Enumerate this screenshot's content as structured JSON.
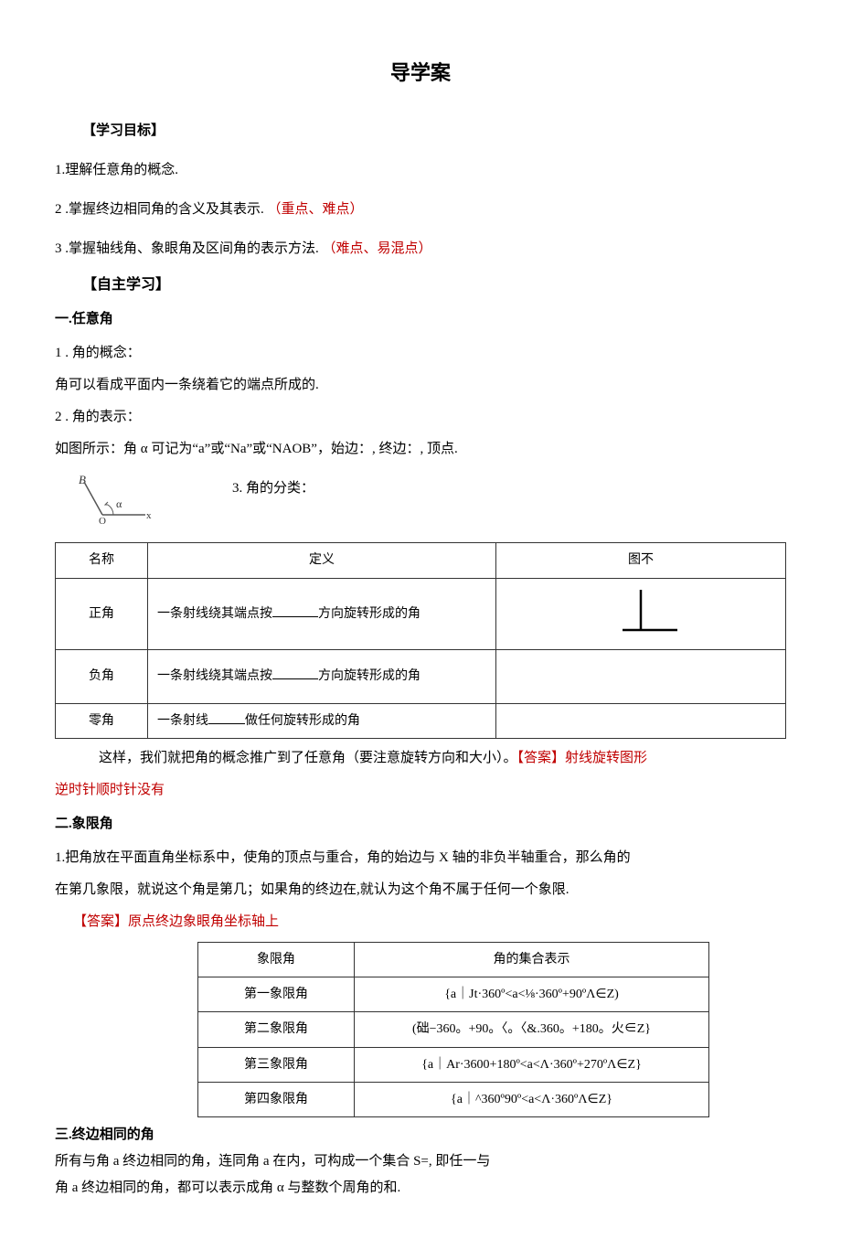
{
  "title": "导学案",
  "goals": {
    "header": "【学习目标】",
    "g1": "1.理解任意角的概念.",
    "g2_prefix": "2 .掌握终边相同角的含义及其表示. ",
    "g2_note": "（重点、难点）",
    "g3_prefix": "3 .掌握轴线角、象眼角及区间角的表示方法. ",
    "g3_note": "（难点、易混点）"
  },
  "self_study": "【自主学习】",
  "arb": {
    "head": "一.任意角",
    "c1": "1 . 角的概念：",
    "c2": "角可以看成平面内一条绕着它的端点所成的.",
    "c3": "2 . 角的表示：",
    "c4": "如图所示：角 α 可记为“a”或“Na”或“NAOB”，始边：, 终边：, 顶点.",
    "c5": "3. 角的分类："
  },
  "table1": {
    "h1": "名称",
    "h2": "定义",
    "h3": "图不",
    "r1c1": "正角",
    "r1c2a": "一条射线绕其端点按",
    "r1c2b": "方向旋转形成的角",
    "r2c1": "负角",
    "r2c2a": "一条射线绕其端点按",
    "r2c2b": "方向旋转形成的角",
    "r3c1": "零角",
    "r3c2a": "一条射线",
    "r3c2b": "做任何旋转形成的角"
  },
  "after_t1_a": "这样，我们就把角的概念推广到了任意角（要注意旋转方向和大小）。",
  "after_t1_b": "【答案】射线旋转图形",
  "after_t1_c": "逆时针顺时针没有",
  "quad": {
    "head": "二.象限角",
    "p1": "1.把角放在平面直角坐标系中，使角的顶点与重合，角的始边与 X 轴的非负半轴重合，那么角的",
    "p2": "在第几象限，就说这个角是第几；如果角的终边在,就认为这个角不属于任何一个象限.",
    "ans_label": "【答案】",
    "ans_text": "原点终边象眼角坐标轴上"
  },
  "table2": {
    "h1": "象限角",
    "h2": "角的集合表示",
    "r1c1": "第一象限角",
    "r1c2": "{a｜Jt·360º<a<⅛·360º+90ºΛ∈Z)",
    "r2c1": "第二象限角",
    "r2c2": "(础−360。+90。〈。〈&.360。+180。火∈Z}",
    "r3c1": "第三象限角",
    "r3c2": "{a｜Ar·3600+180º<a<Λ·360º+270ºΛ∈Z}",
    "r4c1": "第四象限角",
    "r4c2": "{a｜^360º90º<a<Λ·360ºΛ∈Z}"
  },
  "cot": {
    "head": "三.终边相同的角",
    "p1": "所有与角 a 终边相同的角，连同角 a 在内，可构成一个集合 S=, 即任一与",
    "p2": "角 a 终边相同的角，都可以表示成角 α 与整数个周角的和."
  }
}
